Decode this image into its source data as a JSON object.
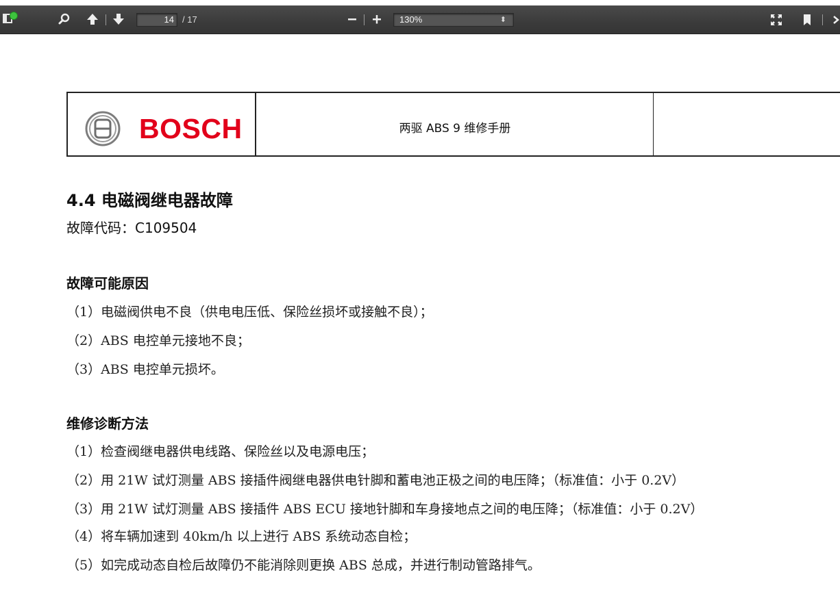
{
  "toolbar": {
    "page_current": "14",
    "page_total": "/ 17",
    "zoom_minus": "−",
    "zoom_plus": "+",
    "zoom_value": "130%",
    "zoom_caret": "⬍"
  },
  "doc": {
    "header": {
      "logo_text": "BOSCH",
      "title": "两驱 ABS 9 维修手册"
    },
    "section_heading": "4.4  电磁阀继电器故障",
    "fault_code": "故障代码：C109504",
    "causes": {
      "heading": "故障可能原因",
      "items": [
        "（1）电磁阀供电不良（供电电压低、保险丝损坏或接触不良）；",
        "（2）ABS 电控单元接地不良；",
        "（3）ABS 电控单元损坏。"
      ]
    },
    "diagnosis": {
      "heading": "维修诊断方法",
      "items": [
        "（1）检查阀继电器供电线路、保险丝以及电源电压；",
        "（2）用 21W 试灯测量 ABS 接插件阀继电器供电针脚和蓄电池正极之间的电压降；（标准值：小于 0.2V）",
        "（3）用 21W 试灯测量 ABS 接插件 ABS  ECU 接地针脚和车身接地点之间的电压降；（标准值：小于 0.2V）",
        "（4）将车辆加速到 40km/h 以上进行 ABS 系统动态自检；",
        "（5）如完成动态自检后故障仍不能消除则更换 ABS 总成，并进行制动管路排气。"
      ]
    }
  },
  "colors": {
    "toolbar_bg": "#3b3b3b",
    "bosch_red": "#e2001a",
    "indicator_green": "#3ec43e"
  }
}
